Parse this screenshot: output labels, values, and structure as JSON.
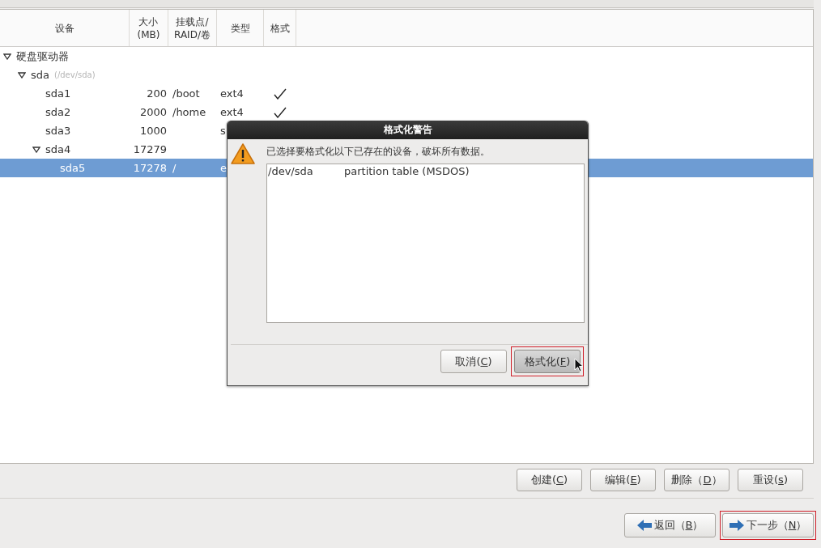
{
  "table": {
    "columns": [
      "设备",
      "大小\n(MB)",
      "挂载点/\nRAID/卷",
      "类型",
      "格式"
    ],
    "rows": [
      {
        "device": "硬盘驱动器",
        "expanded": true,
        "selected": false,
        "children": [
          {
            "device": "sda",
            "note": "(/dev/sda)",
            "expanded": true,
            "selected": false,
            "children": [
              {
                "device": "sda1",
                "size": "200",
                "mount": "/boot",
                "type": "ext4",
                "format": true,
                "selected": false
              },
              {
                "device": "sda2",
                "size": "2000",
                "mount": "/home",
                "type": "ext4",
                "format": true,
                "selected": false
              },
              {
                "device": "sda3",
                "size": "1000",
                "type": "s",
                "selected": false
              },
              {
                "device": "sda4",
                "size": "17279",
                "expanded": true,
                "selected": false,
                "children": [
                  {
                    "device": "sda5",
                    "size": "17278",
                    "mount": "/",
                    "type": "e",
                    "selected": true
                  }
                ]
              }
            ]
          }
        ]
      }
    ]
  },
  "actions": [
    {
      "before": "创建(",
      "key": "C",
      "after": ")"
    },
    {
      "before": "编辑(",
      "key": "E",
      "after": ")"
    },
    {
      "before": "删除（",
      "key": "D",
      "after": "）"
    },
    {
      "before": "重设(",
      "key": "s",
      "after": ")"
    }
  ],
  "navigation": [
    {
      "kind": "back",
      "before": "返回（",
      "key": "B",
      "after": "）",
      "highlighted": false
    },
    {
      "kind": "next",
      "before": "下一步（",
      "key": "N",
      "after": "）",
      "highlighted": true
    }
  ],
  "dialog": {
    "title": "格式化警告",
    "message": "已选择要格式化以下已存在的设备，破坏所有数据。",
    "items": [
      {
        "device": "/dev/sda",
        "description": "partition table (MSDOS)"
      }
    ],
    "buttons": [
      {
        "before": "取消(",
        "key": "C",
        "after": ")",
        "highlighted": false,
        "default": false
      },
      {
        "before": "格式化(",
        "key": "F",
        "after": ")",
        "highlighted": true,
        "default": true
      }
    ]
  }
}
